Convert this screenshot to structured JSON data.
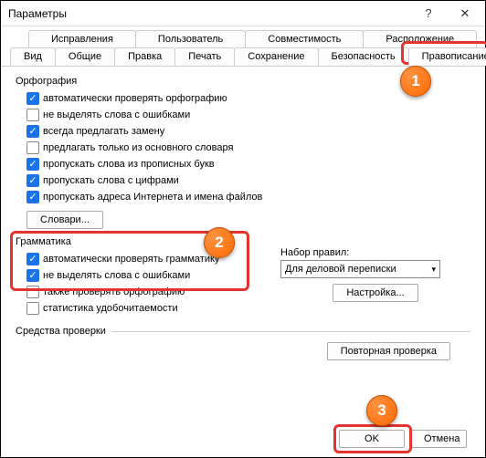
{
  "window": {
    "title": "Параметры"
  },
  "tabs": {
    "row1": [
      "Исправления",
      "Пользователь",
      "Совместимость",
      "Расположение"
    ],
    "row2": [
      "Вид",
      "Общие",
      "Правка",
      "Печать",
      "Сохранение",
      "Безопасность",
      "Правописание"
    ]
  },
  "orthography": {
    "title": "Орфография",
    "checks": [
      {
        "label": "автоматически проверять орфографию",
        "checked": true
      },
      {
        "label": "не выделять слова с ошибками",
        "checked": false
      },
      {
        "label": "всегда предлагать замену",
        "checked": true
      },
      {
        "label": "предлагать только из основного словаря",
        "checked": false
      },
      {
        "label": "пропускать слова из прописных букв",
        "checked": true
      },
      {
        "label": "пропускать слова с цифрами",
        "checked": true
      },
      {
        "label": "пропускать адреса Интернета и имена файлов",
        "checked": true
      }
    ],
    "dict_btn": "Словари..."
  },
  "grammar": {
    "title": "Грамматика",
    "checks": [
      {
        "label": "автоматически проверять грамматику",
        "checked": true
      },
      {
        "label": "не выделять слова с ошибками",
        "checked": true
      },
      {
        "label": "также проверять орфографию",
        "checked": false
      },
      {
        "label": "статистика удобочитаемости",
        "checked": false
      }
    ]
  },
  "ruleset": {
    "label": "Набор правил:",
    "value": "Для деловой переписки",
    "settings_btn": "Настройка..."
  },
  "tools": {
    "title": "Средства проверки",
    "recheck_btn": "Повторная проверка"
  },
  "buttons": {
    "ok": "OK",
    "cancel": "Отмена"
  },
  "callouts": {
    "c1": "1",
    "c2": "2",
    "c3": "3"
  }
}
